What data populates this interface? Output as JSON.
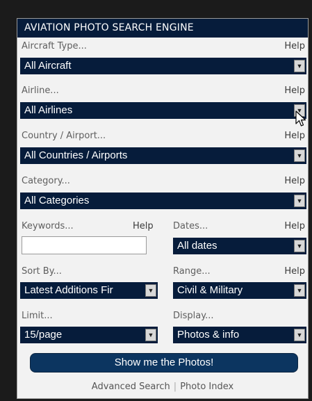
{
  "header": {
    "title": "AVIATION PHOTO SEARCH ENGINE"
  },
  "aircraft_type": {
    "label": "Aircraft Type...",
    "help": "Help",
    "value": "All Aircraft"
  },
  "airline": {
    "label": "Airline...",
    "help": "Help",
    "value": "All Airlines"
  },
  "country_airport": {
    "label": "Country / Airport...",
    "help": "Help",
    "value": "All Countries / Airports"
  },
  "category": {
    "label": "Category...",
    "help": "Help",
    "value": "All Categories"
  },
  "keywords": {
    "label": "Keywords...",
    "help": "Help",
    "value": ""
  },
  "dates": {
    "label": "Dates...",
    "help": "Help",
    "value": "All dates"
  },
  "sort_by": {
    "label": "Sort By...",
    "value": "Latest Additions Fir"
  },
  "range": {
    "label": "Range...",
    "help": "Help",
    "value": "Civil & Military"
  },
  "limit": {
    "label": "Limit...",
    "value": "15/page"
  },
  "display": {
    "label": "Display...",
    "value": "Photos & info"
  },
  "submit": {
    "label": "Show me the Photos!"
  },
  "footer": {
    "advanced_search": "Advanced Search",
    "separator": "|",
    "photo_index": "Photo Index"
  },
  "icons": {
    "dropdown": "chevron-down-icon",
    "pointer": "cursor-icon"
  },
  "colors": {
    "header_bg": "#061c3b",
    "select_bg": "#061c3b",
    "button_bg": "#0c3560",
    "panel_bg": "#f2f2f2"
  }
}
